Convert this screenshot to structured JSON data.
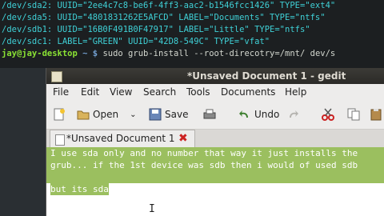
{
  "terminal": {
    "lines": [
      "/dev/sda2: UUID=\"2ee4c7c8-be6f-4ff3-aac2-b1546fcc1426\" TYPE=\"ext4\"",
      "/dev/sda5: UUID=\"4801831262E5AFCD\" LABEL=\"Documents\" TYPE=\"ntfs\"",
      "/dev/sdb1: UUID=\"16B0F491B0F47917\" LABEL=\"Little\" TYPE=\"ntfs\"",
      "/dev/sdc1: LABEL=\"GREEN\" UUID=\"42D8-549C\" TYPE=\"vfat\""
    ],
    "prompt_user": "jay@jay-desktop",
    "prompt_path": " ~ $ ",
    "command": "sudo grub-install --root-direcotry=/mnt/ dev/s"
  },
  "window": {
    "title": "*Unsaved Document 1 - gedit"
  },
  "menu": [
    "File",
    "Edit",
    "View",
    "Search",
    "Tools",
    "Documents",
    "Help"
  ],
  "toolbar": {
    "open_label": "Open",
    "save_label": "Save",
    "undo_label": "Undo"
  },
  "tab": {
    "label": "*Unsaved Document 1",
    "close_glyph": "✖"
  },
  "editor": {
    "lines": [
      "I use sda only and no number that way it just installs the",
      "grub... if the 1st device was sdb then i would of used sdb",
      "",
      "but its sda"
    ]
  },
  "colors": {
    "selection": "#9bbf5f",
    "terminal_text": "#3fd0d6"
  }
}
